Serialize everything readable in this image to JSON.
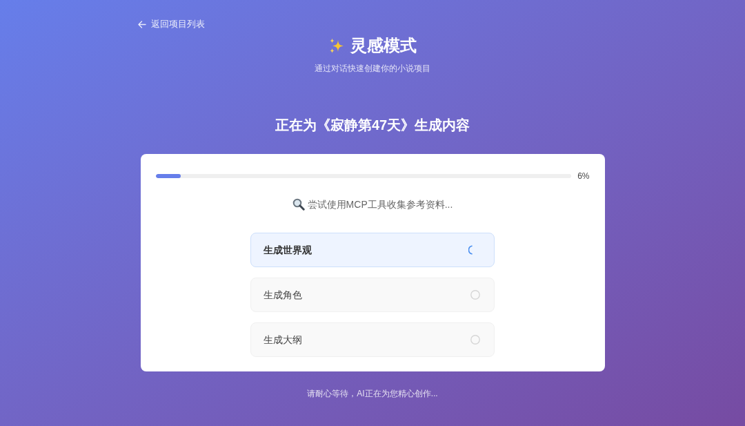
{
  "back_link": {
    "label": "返回项目列表"
  },
  "header": {
    "title": "灵感模式",
    "subtitle": "通过对话快速创建你的小说项目"
  },
  "heading": "正在为《寂静第47天》生成内容",
  "progress": {
    "level": 0.06,
    "reading": "6%"
  },
  "status_message": "尝试使用MCP工具收集参考资料...",
  "steps": [
    {
      "label": "生成世界观",
      "active": true
    },
    {
      "label": "生成角色",
      "active": false
    },
    {
      "label": "生成大纲",
      "active": false
    }
  ],
  "footer_note": "请耐心等待，AI正在为您精心创作..."
}
